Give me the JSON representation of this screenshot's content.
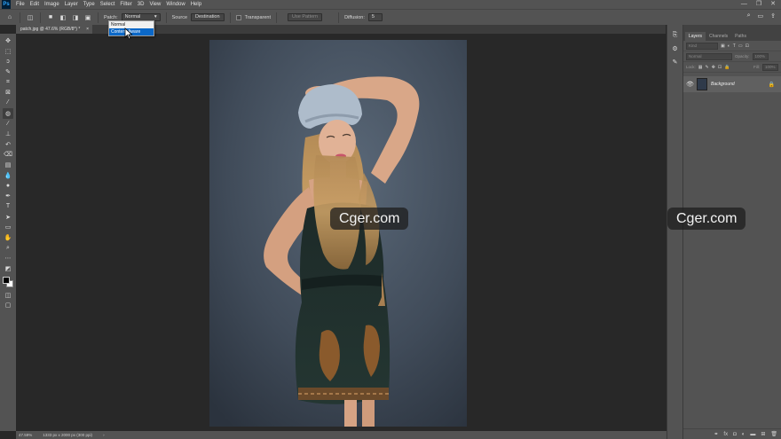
{
  "app": {
    "logo": "Ps"
  },
  "menu": [
    "File",
    "Edit",
    "Image",
    "Layer",
    "Type",
    "Select",
    "Filter",
    "3D",
    "View",
    "Window",
    "Help"
  ],
  "window_controls": [
    "—",
    "❐",
    "✕"
  ],
  "options": {
    "patch_label": "Patch:",
    "patch_value": "Normal",
    "source_label": "Source",
    "destination_label": "Destination",
    "transparent_label": "Transparent",
    "use_pattern_label": "Use Pattern",
    "diffusion_label": "Diffusion:",
    "diffusion_value": "5"
  },
  "dropdown": {
    "options": [
      "Normal",
      "Content-Aware"
    ],
    "selected_index": 1
  },
  "document": {
    "tab_title": "patch.jpg @ 47.6% (RGB/8*) *",
    "close": "×"
  },
  "status": {
    "zoom": "47.59%",
    "dimensions": "1333 px x 2000 px (300 ppi)",
    "arrow": "›"
  },
  "layers_panel": {
    "tabs": [
      "Layers",
      "Channels",
      "Paths"
    ],
    "kind_placeholder": "Kind",
    "blend_mode": "Normal",
    "opacity_label": "Opacity:",
    "opacity_value": "100%",
    "lock_label": "Lock:",
    "fill_label": "Fill:",
    "fill_value": "100%",
    "layer_name": "Background"
  },
  "watermark": "Cger.com",
  "colors": {
    "accent": "#0b68c8",
    "panel": "#535353",
    "canvas": "#282828"
  }
}
